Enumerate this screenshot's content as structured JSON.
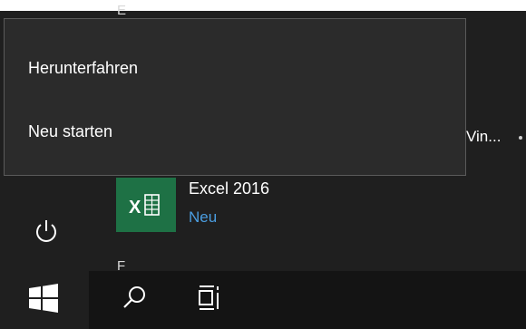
{
  "start_menu": {
    "section_letter_top": "E",
    "section_letter_bottom": "F",
    "truncated_app_label": "Vin...",
    "power_flyout": {
      "shutdown_label": "Herunterfahren",
      "restart_label": "Neu starten"
    },
    "app_tile": {
      "name": "Excel 2016",
      "badge": "Neu",
      "tile_color": "#1e7145",
      "icon": "excel-icon"
    },
    "power_icon": "power-icon"
  },
  "taskbar": {
    "start_icon": "windows-logo-icon",
    "search_icon": "search-icon",
    "task_view_icon": "task-view-icon"
  },
  "colors": {
    "menu_background": "#1f1f1f",
    "flyout_background": "#2b2b2b",
    "accent": "#4a9de0",
    "taskbar": "#141414"
  }
}
